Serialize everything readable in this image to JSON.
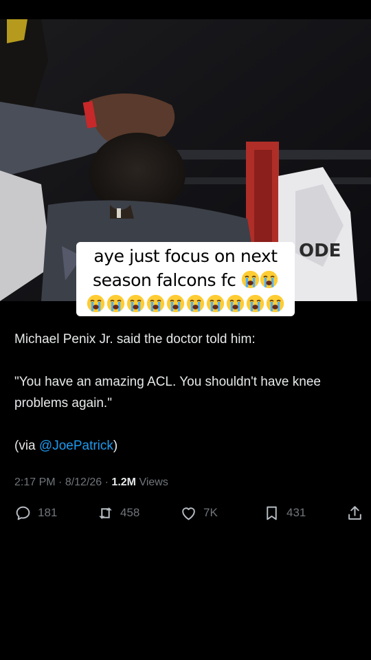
{
  "caption": {
    "line1": "aye just focus on next",
    "line2": "season falcons fc",
    "emoji_name": "loudly-crying-face"
  },
  "tweet": {
    "line1": "Michael Penix Jr. said the doctor told him:",
    "quote": "\"You have an amazing ACL. You shouldn't have knee problems again.\"",
    "via_prefix": "(via ",
    "mention": "@JoePatrick",
    "via_suffix": ")"
  },
  "meta": {
    "time": "2:17 PM",
    "sep1": " · ",
    "date": "8/12/26",
    "sep2": " · ",
    "views_count": "1.2M",
    "views_label": " Views"
  },
  "actions": {
    "replies": "181",
    "reposts": "458",
    "likes": "7K",
    "bookmarks": "431"
  },
  "icons": {
    "reply": "reply-icon",
    "repost": "repost-icon",
    "like": "like-icon",
    "bookmark": "bookmark-icon",
    "share": "share-icon"
  },
  "colors": {
    "background": "#000000",
    "text": "#e7e9ea",
    "muted": "#71767b",
    "link": "#1d9bf0",
    "caption_bg": "#ffffff"
  }
}
